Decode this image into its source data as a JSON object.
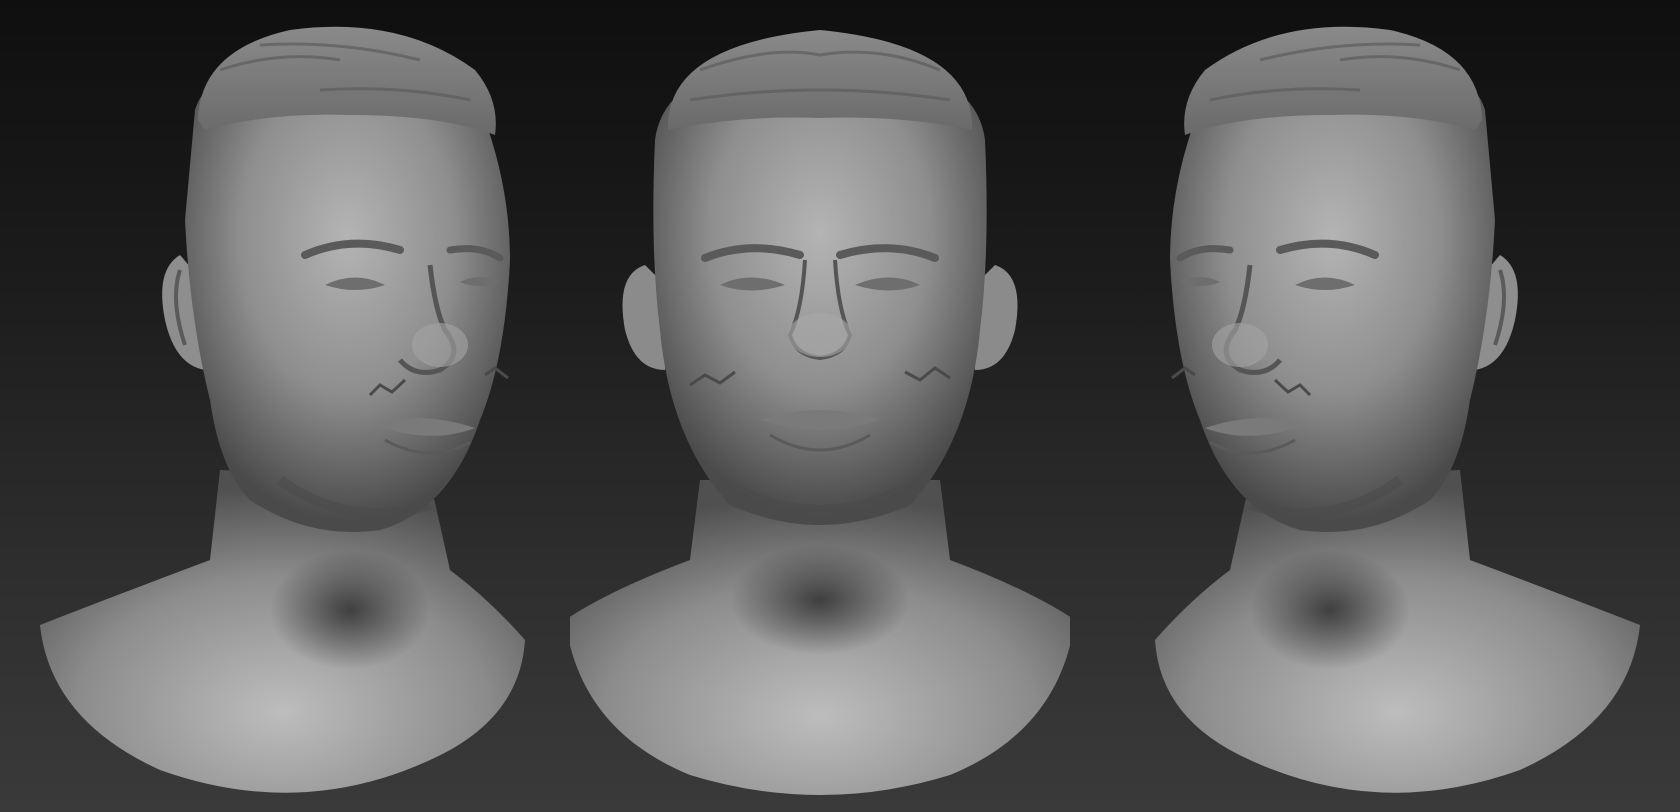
{
  "scene": {
    "subject": "",
    "views": [
      {
        "id": "left",
        "view": "three-quarter-left"
      },
      {
        "id": "center",
        "view": "front"
      },
      {
        "id": "right",
        "view": "three-quarter-right"
      }
    ],
    "colors": {
      "background_top": "#0f0f0f",
      "background_bottom": "#3a3a3a",
      "clay_highlight": "#b9b9b9",
      "clay_mid": "#8a8a8a",
      "clay_shadow": "#3d3d3d"
    }
  }
}
